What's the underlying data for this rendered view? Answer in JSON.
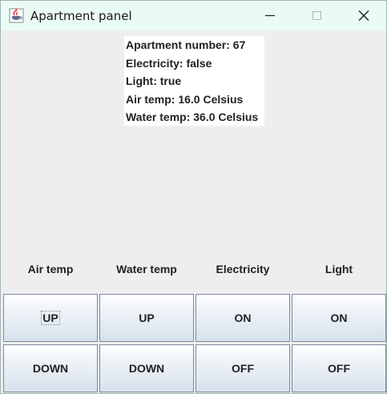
{
  "window": {
    "title": "Apartment panel",
    "icon": "java-cup-icon",
    "controls": [
      "minimize-icon",
      "maximize-icon",
      "close-icon"
    ]
  },
  "info": {
    "apartment_number": "Apartment number: 67",
    "electricity": "Electricity: false",
    "light": "Light: true",
    "air_temp": "Air temp: 16.0 Celsius",
    "water_temp": "Water temp: 36.0 Celsius"
  },
  "columns": [
    {
      "label": "Air temp",
      "top_button": "UP",
      "bottom_button": "DOWN"
    },
    {
      "label": "Water temp",
      "top_button": "UP",
      "bottom_button": "DOWN"
    },
    {
      "label": "Electricity",
      "top_button": "ON",
      "bottom_button": "OFF"
    },
    {
      "label": "Light",
      "top_button": "ON",
      "bottom_button": "OFF"
    }
  ]
}
